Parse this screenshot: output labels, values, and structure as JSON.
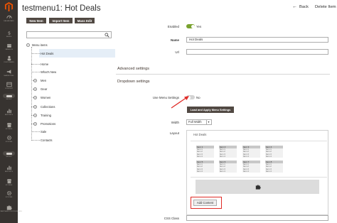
{
  "sidebar": {
    "items": [
      {
        "label": "DASHBOARD",
        "icon": "dashboard-icon"
      },
      {
        "label": "SALES",
        "icon": "dollar-icon"
      },
      {
        "label": "CATALOG",
        "icon": "box-icon"
      },
      {
        "label": "CUSTOMERS",
        "icon": "person-icon"
      },
      {
        "label": "MARKETING",
        "icon": "megaphone-icon"
      },
      {
        "label": "CONTENT",
        "icon": "layout-icon"
      },
      {
        "label": "GROUP",
        "icon": "pill-icon"
      },
      {
        "label": "REPORTS",
        "icon": "bars-icon"
      },
      {
        "label": "STORES",
        "icon": "store-icon"
      },
      {
        "label": "SYSTEM",
        "icon": "gear-icon"
      },
      {
        "label": "GROUP",
        "icon": "pill-icon"
      },
      {
        "label": "REPORTS",
        "icon": "bars-icon"
      },
      {
        "label": "STORES",
        "icon": "store-icon"
      },
      {
        "label": "SYSTEM",
        "icon": "gear-icon"
      },
      {
        "label": "FIND PARTNERS & EXTENSIONS",
        "icon": "puzzle-icon"
      }
    ]
  },
  "header": {
    "title": "testmenu1: Hot Deals",
    "back_label": "Back",
    "delete_label": "Delete Item"
  },
  "toolbar": {
    "new_item": "New Item",
    "import_item": "Import Item",
    "mass_edit": "Mass Edit"
  },
  "search": {
    "placeholder": ""
  },
  "tree": {
    "root": "Menu items",
    "items": [
      "Hot Deals",
      "Home",
      "What's New",
      "Men",
      "Gear",
      "Women",
      "Collections",
      "Training",
      "Promotions",
      "Sale",
      "Contacts"
    ]
  },
  "form": {
    "enabled_label": "Enabled",
    "enabled_value": "Yes",
    "name_label": "Name",
    "name_value": "Hot Deals",
    "url_label": "Url",
    "url_value": "",
    "advanced_settings": "Advanced settings",
    "dropdown_settings": "Dropdown settings",
    "use_menu_settings_label": "Use Menu Settings",
    "use_menu_settings_value": "No",
    "apply_button": "Load and Apply Menu Settings",
    "width_label": "Width",
    "width_value": "Full Width",
    "layout_label": "Layout",
    "layout_title": "Hot Deals",
    "add_content": "Add Content",
    "css_class_label": "CSS Class",
    "css_class_value": ""
  },
  "layout_grid": {
    "columns": [
      {
        "header": "Item 1",
        "items": [
          "Item 1",
          "Item 2",
          "Item 3",
          "Item 4"
        ]
      },
      {
        "header": "Item 2",
        "items": [
          "Item 1",
          "Item 2",
          "Item 3",
          "Item 4"
        ]
      },
      {
        "header": "Item 3",
        "items": [
          "Item 1",
          "Item 2",
          "Item 3",
          "Item 4"
        ]
      },
      {
        "header": "Item 4",
        "items": [
          "Item 1",
          "Item 2",
          "Item 3",
          "Item 4"
        ]
      },
      {
        "header": "Item 5",
        "items": [
          "Item 1",
          "Item 2",
          "Item 3",
          "Item 4"
        ]
      },
      {
        "header": "Item 6",
        "items": [
          "Item 1",
          "Item 2",
          "Item 3",
          "Item 4"
        ]
      },
      {
        "header": "Item 7",
        "items": [
          "Item 1",
          "Item 2",
          "Item 3",
          "Item 4"
        ]
      },
      {
        "header": "Item 8",
        "items": [
          "Item 1",
          "Item 2",
          "Item 3",
          "Item 4"
        ]
      }
    ]
  },
  "colors": {
    "sidebar_bg": "#373330",
    "button_dark": "#514943",
    "toggle_on": "#79a22e",
    "toggle_off": "#d3d3d3",
    "highlight_red": "#e02b27",
    "selected_row": "#e5eef7",
    "magento_orange": "#eb5202"
  }
}
